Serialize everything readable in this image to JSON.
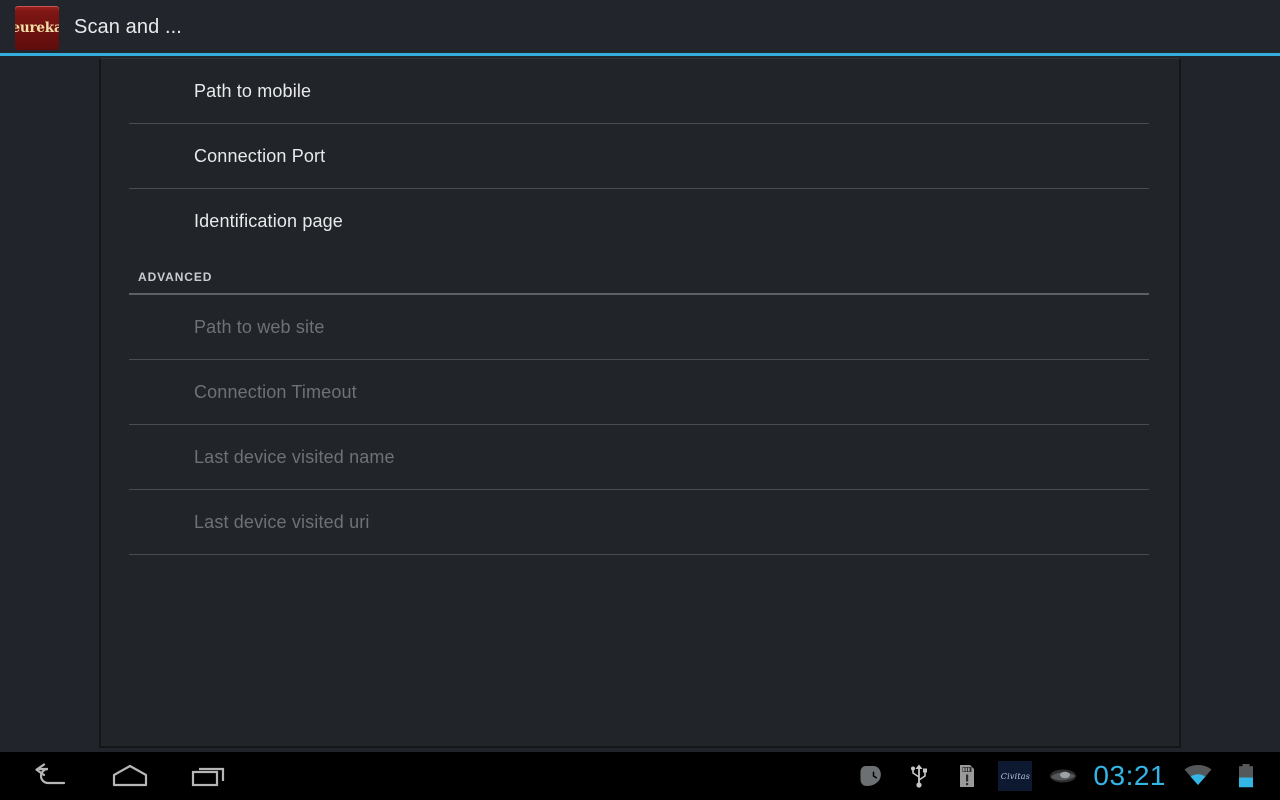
{
  "action_bar": {
    "app_icon_label": "eureka",
    "title": "Scan and ...",
    "accent_color": "#33aedd"
  },
  "preferences": {
    "main_items": [
      {
        "label": "Path to mobile",
        "enabled": true
      },
      {
        "label": "Connection Port",
        "enabled": true
      },
      {
        "label": "Identification page",
        "enabled": true
      }
    ],
    "section_label": "ADVANCED",
    "advanced_items": [
      {
        "label": "Path to web site",
        "enabled": false
      },
      {
        "label": "Connection Timeout",
        "enabled": false
      },
      {
        "label": "Last device visited name",
        "enabled": false
      },
      {
        "label": "Last device visited uri",
        "enabled": false
      }
    ]
  },
  "nav_bar": {
    "back_icon": "back-arrow-icon",
    "home_icon": "home-icon",
    "recents_icon": "recent-apps-icon"
  },
  "status_bar": {
    "clock": "03:21",
    "clock_color": "#33b5e5",
    "icons": [
      "skype-clock-icon",
      "usb-icon",
      "sim-card-alert-icon",
      "civitas-app-icon",
      "eye-icon",
      "wifi-icon",
      "battery-icon"
    ],
    "civitas_label": "Civitas"
  }
}
